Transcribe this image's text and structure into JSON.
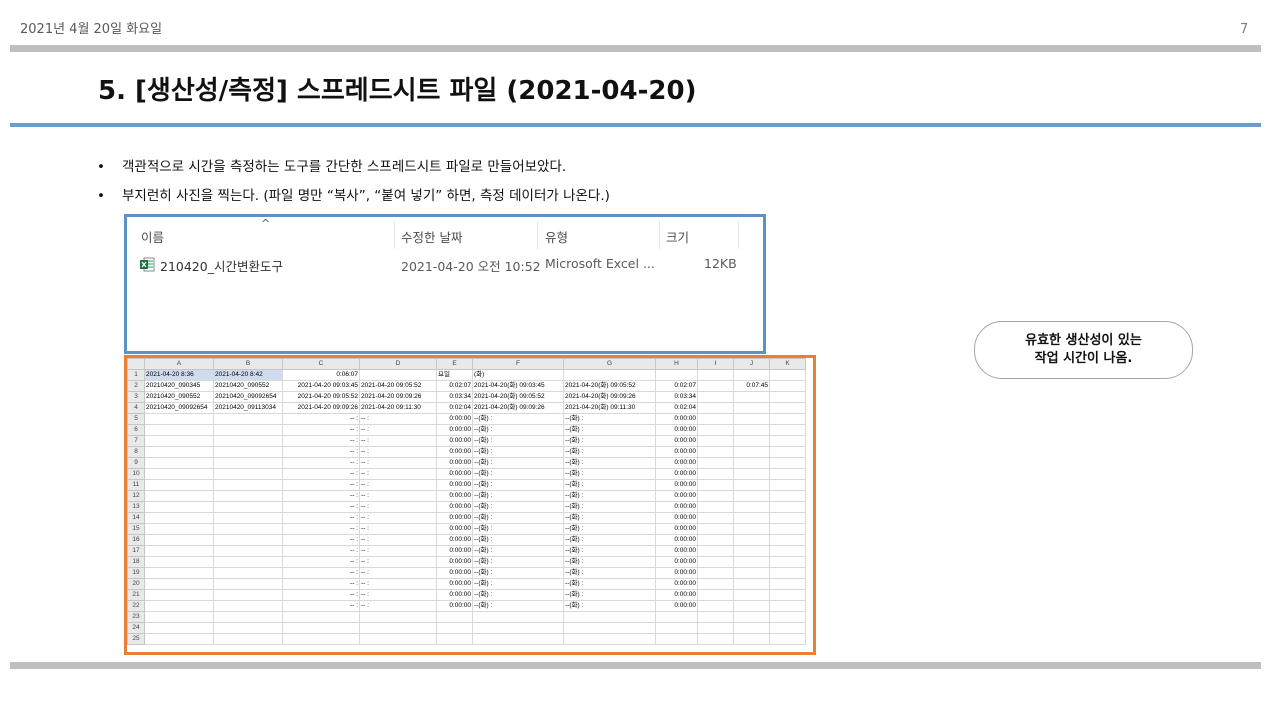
{
  "header": {
    "date": "2021년 4월 20일 화요일",
    "page_number": "7",
    "title": "5. [생산성/측정] 스프레드시트 파일 (2021-04-20)"
  },
  "bullets": [
    "객관적으로 시간을 측정하는 도구를 간단한 스프레드시트 파일로 만들어보았다.",
    "부지런히 사진을 찍는다. (파일 명만 “복사”, “붙여 넣기” 하면, 측정 데이터가 나온다.)"
  ],
  "bullet_symbol": "•",
  "explorer": {
    "sort_caret": "^",
    "columns": {
      "name": "이름",
      "modified": "수정한 날짜",
      "type": "유형",
      "size": "크기"
    },
    "file": {
      "icon": "excel-file-icon",
      "name": "210420_시간변환도구",
      "modified": "2021-04-20 오전 10:52",
      "type": "Microsoft Excel ...",
      "size": "12KB"
    }
  },
  "spreadsheet": {
    "columns": [
      "A",
      "B",
      "C",
      "D",
      "E",
      "F",
      "G",
      "H",
      "I",
      "J",
      "K"
    ],
    "rows": [
      [
        "2021-04-20 8:36",
        "2021-04-20 8:42",
        "0:06:07",
        "",
        "요일",
        "(화)",
        "",
        "",
        "",
        "",
        ""
      ],
      [
        "20210420_090345",
        "20210420_090552",
        "2021-04-20 09:03:45",
        "2021-04-20 09:05:52",
        "0:02:07",
        "2021-04-20(화) 09:03:45",
        "2021-04-20(화) 09:05:52",
        "0:02:07",
        "",
        "0:07:45",
        ""
      ],
      [
        "20210420_090552",
        "20210420_09092654",
        "2021-04-20 09:05:52",
        "2021-04-20 09:09:26",
        "0:03:34",
        "2021-04-20(화) 09:05:52",
        "2021-04-20(화) 09:09:26",
        "0:03:34",
        "",
        "",
        ""
      ],
      [
        "20210420_09092654",
        "20210420_09113034",
        "2021-04-20 09:09:26",
        "2021-04-20 09:11:30",
        "0:02:04",
        "2021-04-20(화) 09:09:26",
        "2021-04-20(화) 09:11:30",
        "0:02:04",
        "",
        "",
        ""
      ],
      [
        "",
        "",
        "-- :",
        "-- :",
        "0:00:00",
        "--(화) :",
        "--(화) :",
        "0:00:00",
        "",
        "",
        ""
      ],
      [
        "",
        "",
        "-- :",
        "-- :",
        "0:00:00",
        "--(화) :",
        "--(화) :",
        "0:00:00",
        "",
        "",
        ""
      ],
      [
        "",
        "",
        "-- :",
        "-- :",
        "0:00:00",
        "--(화) :",
        "--(화) :",
        "0:00:00",
        "",
        "",
        ""
      ],
      [
        "",
        "",
        "-- :",
        "-- :",
        "0:00:00",
        "--(화) :",
        "--(화) :",
        "0:00:00",
        "",
        "",
        ""
      ],
      [
        "",
        "",
        "-- :",
        "-- :",
        "0:00:00",
        "--(화) :",
        "--(화) :",
        "0:00:00",
        "",
        "",
        ""
      ],
      [
        "",
        "",
        "-- :",
        "-- :",
        "0:00:00",
        "--(화) :",
        "--(화) :",
        "0:00:00",
        "",
        "",
        ""
      ],
      [
        "",
        "",
        "-- :",
        "-- :",
        "0:00:00",
        "--(화) :",
        "--(화) :",
        "0:00:00",
        "",
        "",
        ""
      ],
      [
        "",
        "",
        "-- :",
        "-- :",
        "0:00:00",
        "--(화) :",
        "--(화) :",
        "0:00:00",
        "",
        "",
        ""
      ],
      [
        "",
        "",
        "-- :",
        "-- :",
        "0:00:00",
        "--(화) :",
        "--(화) :",
        "0:00:00",
        "",
        "",
        ""
      ],
      [
        "",
        "",
        "-- :",
        "-- :",
        "0:00:00",
        "--(화) :",
        "--(화) :",
        "0:00:00",
        "",
        "",
        ""
      ],
      [
        "",
        "",
        "-- :",
        "-- :",
        "0:00:00",
        "--(화) :",
        "--(화) :",
        "0:00:00",
        "",
        "",
        ""
      ],
      [
        "",
        "",
        "-- :",
        "-- :",
        "0:00:00",
        "--(화) :",
        "--(화) :",
        "0:00:00",
        "",
        "",
        ""
      ],
      [
        "",
        "",
        "-- :",
        "-- :",
        "0:00:00",
        "--(화) :",
        "--(화) :",
        "0:00:00",
        "",
        "",
        ""
      ],
      [
        "",
        "",
        "-- :",
        "-- :",
        "0:00:00",
        "--(화) :",
        "--(화) :",
        "0:00:00",
        "",
        "",
        ""
      ],
      [
        "",
        "",
        "-- :",
        "-- :",
        "0:00:00",
        "--(화) :",
        "--(화) :",
        "0:00:00",
        "",
        "",
        ""
      ],
      [
        "",
        "",
        "-- :",
        "-- :",
        "0:00:00",
        "--(화) :",
        "--(화) :",
        "0:00:00",
        "",
        "",
        ""
      ],
      [
        "",
        "",
        "-- :",
        "-- :",
        "0:00:00",
        "--(화) :",
        "--(화) :",
        "0:00:00",
        "",
        "",
        ""
      ],
      [
        "",
        "",
        "-- :",
        "-- :",
        "0:00:00",
        "--(화) :",
        "--(화) :",
        "0:00:00",
        "",
        "",
        ""
      ],
      [
        "",
        "",
        "",
        "",
        "",
        "",
        "",
        "",
        "",
        "",
        ""
      ],
      [
        "",
        "",
        "",
        "",
        "",
        "",
        "",
        "",
        "",
        "",
        ""
      ],
      [
        "",
        "",
        "",
        "",
        "",
        "",
        "",
        "",
        "",
        "",
        ""
      ]
    ],
    "selected_color": "#cfdcf0"
  },
  "callout": {
    "line1": "유효한 생산성이 있는",
    "line2": "작업 시간이 나옴."
  },
  "colors": {
    "title_rule": "#6f9cc4",
    "explorer_border": "#5b93c6",
    "sheet_border": "#e8803a",
    "bars": "#bfbfbf"
  }
}
